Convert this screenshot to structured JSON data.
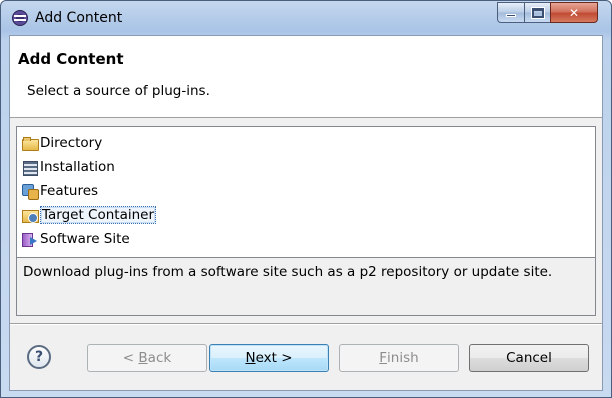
{
  "window": {
    "title": "Add Content"
  },
  "header": {
    "title": "Add Content",
    "description": "Select a source of plug-ins."
  },
  "sources": [
    {
      "label": "Directory",
      "icon": "folder-icon"
    },
    {
      "label": "Installation",
      "icon": "installation-icon"
    },
    {
      "label": "Features",
      "icon": "features-icon"
    },
    {
      "label": "Target Container",
      "icon": "target-container-icon",
      "selected": true
    },
    {
      "label": "Software Site",
      "icon": "software-site-icon"
    }
  ],
  "detail": {
    "text": "Download plug-ins from a software site such as a p2 repository or update site."
  },
  "buttons": {
    "back": {
      "prefix": "< ",
      "mnemonic": "B",
      "rest": "ack",
      "enabled": false
    },
    "next": {
      "mnemonic": "N",
      "rest": "ext >",
      "enabled": true
    },
    "finish": {
      "mnemonic": "F",
      "rest": "inish",
      "enabled": false
    },
    "cancel": {
      "label": "Cancel",
      "enabled": true
    }
  },
  "help": {
    "glyph": "?"
  }
}
